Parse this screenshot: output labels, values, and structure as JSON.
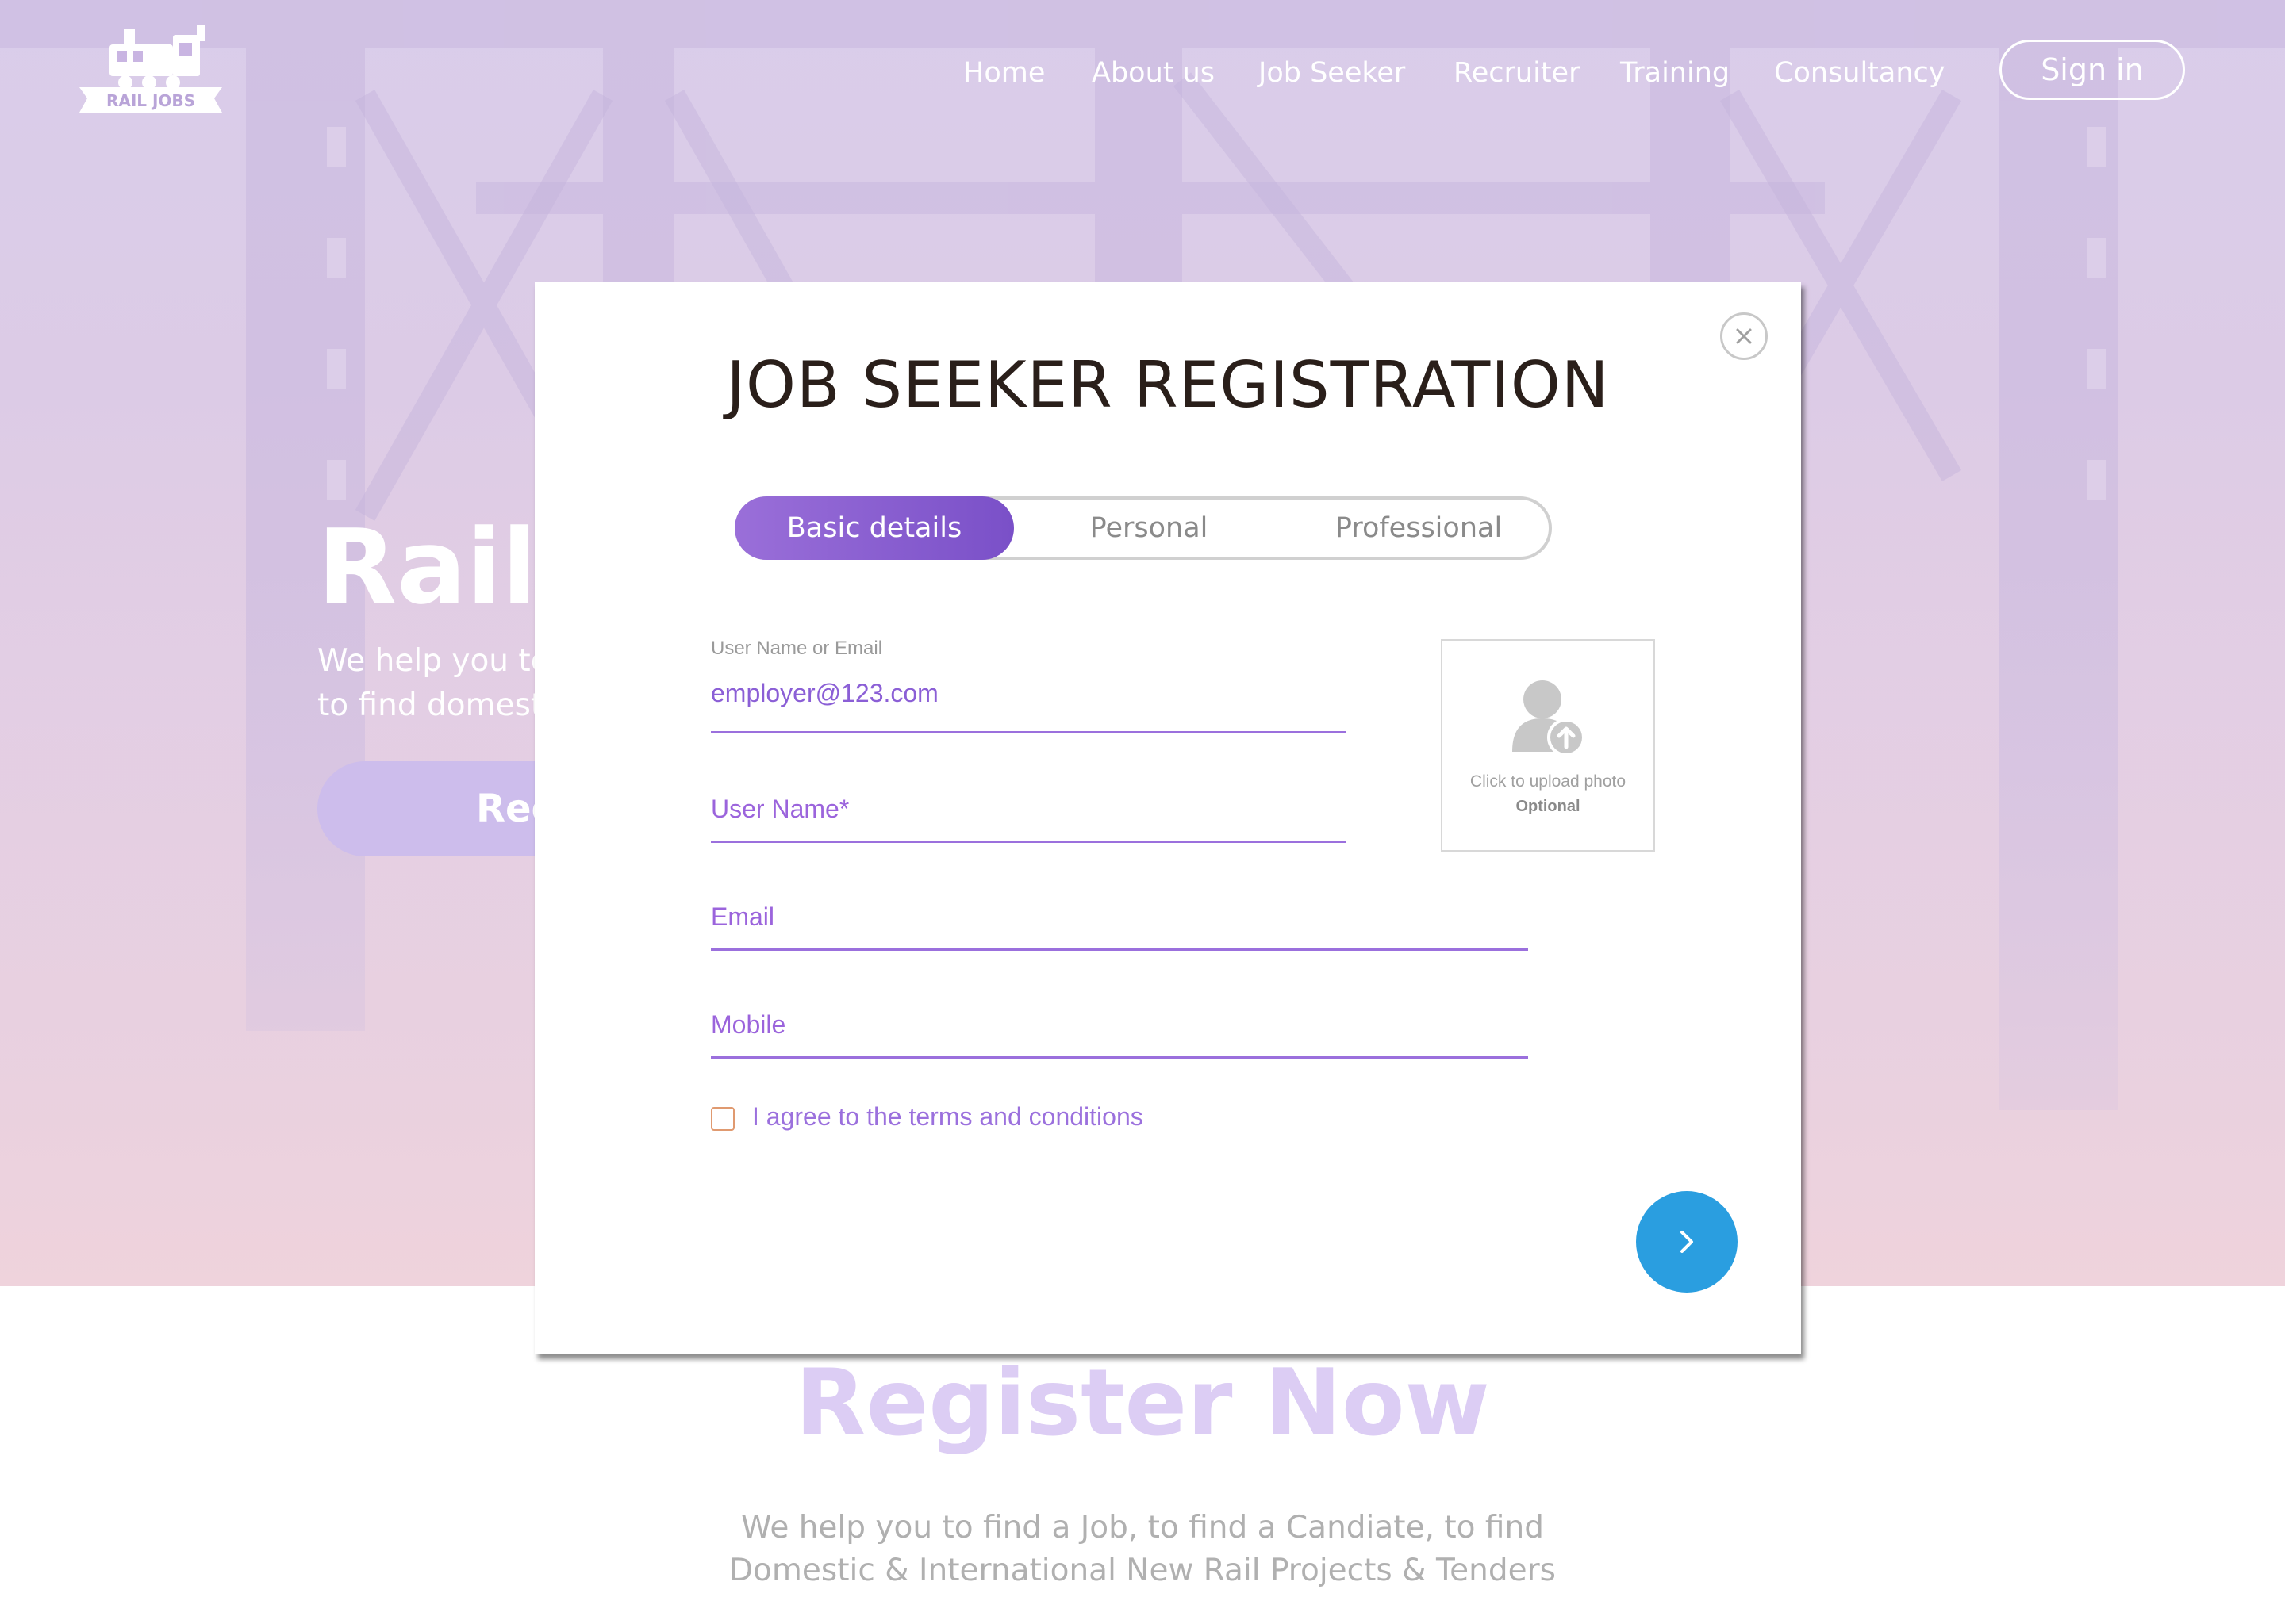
{
  "brand": {
    "logo_text": "RAIL JOBS"
  },
  "nav": {
    "items": [
      "Home",
      "About us",
      "Job Seeker",
      "Recruiter",
      "Training",
      "Consultancy"
    ],
    "signin_label": "Sign in"
  },
  "hero": {
    "title": "Rail J",
    "subtitle_line1": "We help you to",
    "subtitle_line2": "to find domesti",
    "button_label": "Reg"
  },
  "register_section": {
    "title": "Register Now",
    "subtitle": "We help you to find a Job, to find a Candiate, to find Domestic & International New Rail Projects & Tenders"
  },
  "modal": {
    "title": "JOB SEEKER REGISTRATION",
    "tabs": [
      {
        "label": "Basic details",
        "active": true
      },
      {
        "label": "Personal",
        "active": false
      },
      {
        "label": "Professional",
        "active": false
      }
    ],
    "fields": {
      "username_or_email": {
        "label": "User Name or Email",
        "value": "employer@123.com"
      },
      "user_name": {
        "placeholder": "User Name*"
      },
      "email": {
        "placeholder": "Email"
      },
      "mobile": {
        "placeholder": "Mobile"
      }
    },
    "photo_upload": {
      "text": "Click to upload photo",
      "note": "Optional"
    },
    "terms_label": "I agree to the terms and conditions",
    "terms_checked": false
  },
  "colors": {
    "accent_purple": "#8b5fd6",
    "next_button": "#2a9ee0",
    "register_title": "#dccdf4"
  },
  "icons": [
    "close-icon",
    "user-upload-icon",
    "chevron-right-icon",
    "train-logo-icon"
  ]
}
